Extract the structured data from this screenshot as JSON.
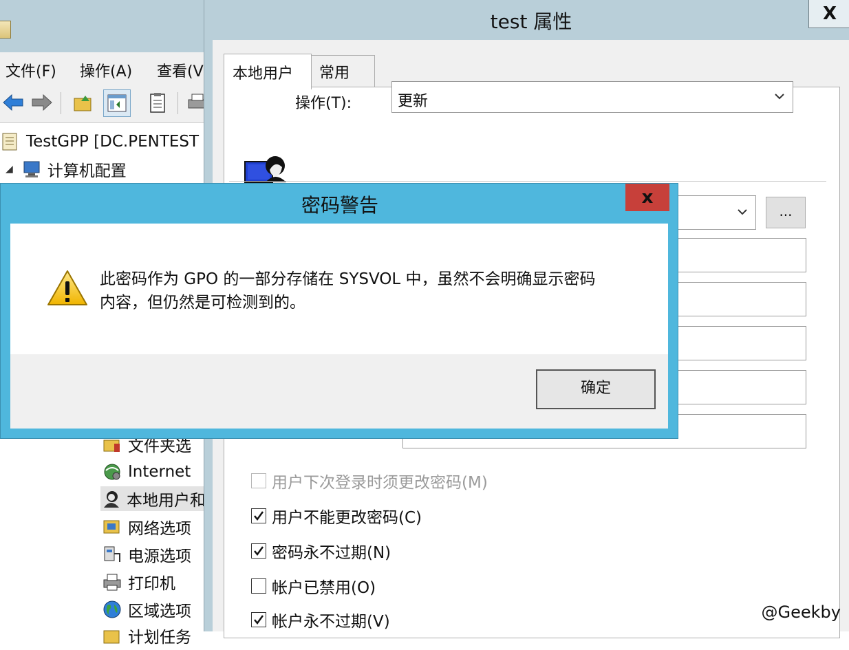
{
  "background_window": {
    "menu": [
      "文件(F)",
      "操作(A)",
      "查看(V"
    ],
    "tree": [
      {
        "label": "TestGPP [DC.PENTEST",
        "icon": "policy-document-icon"
      },
      {
        "label": "计算机配置",
        "icon": "computer-icon",
        "expander": "◢"
      },
      {
        "label": "文件夹选",
        "icon": "folder-options-icon"
      },
      {
        "label": "Internet",
        "icon": "internet-settings-icon"
      },
      {
        "label": "本地用户和",
        "icon": "local-users-icon",
        "selected": true
      },
      {
        "label": "网络选项",
        "icon": "network-options-icon"
      },
      {
        "label": "电源选项",
        "icon": "power-options-icon"
      },
      {
        "label": "打印机",
        "icon": "printer-icon"
      },
      {
        "label": "区域选项",
        "icon": "regional-options-icon"
      },
      {
        "label": "计划任务",
        "icon": "scheduled-tasks-icon"
      }
    ]
  },
  "properties_dialog": {
    "title": "test 属性",
    "close_glyph": "X",
    "tabs": [
      {
        "label": "本地用户",
        "active": true
      },
      {
        "label": "常用",
        "active": false
      }
    ],
    "action_label": "操作(T):",
    "action_value": "更新",
    "browse_label": "...",
    "checkboxes": [
      {
        "label": "用户下次登录时须更改密码(M)",
        "checked": false,
        "disabled": true
      },
      {
        "label": "用户不能更改密码(C)",
        "checked": true,
        "disabled": false
      },
      {
        "label": "密码永不过期(N)",
        "checked": true,
        "disabled": false
      },
      {
        "label": "帐户已禁用(O)",
        "checked": false,
        "disabled": false
      },
      {
        "label": "帐户永不过期(V)",
        "checked": true,
        "disabled": false
      }
    ]
  },
  "warning_dialog": {
    "title": "密码警告",
    "close_glyph": "x",
    "message_line1": "此密码作为 GPO 的一部分存储在 SYSVOL 中，虽然不会明确显示密码",
    "message_line2": "内容，但仍然是可检测到的。",
    "ok_label": "确定"
  },
  "watermark": "@Geekby",
  "colors": {
    "dialog_frame": "#b9cfd9",
    "warning_frame": "#4fb7dd",
    "close_red": "#c7403a"
  }
}
